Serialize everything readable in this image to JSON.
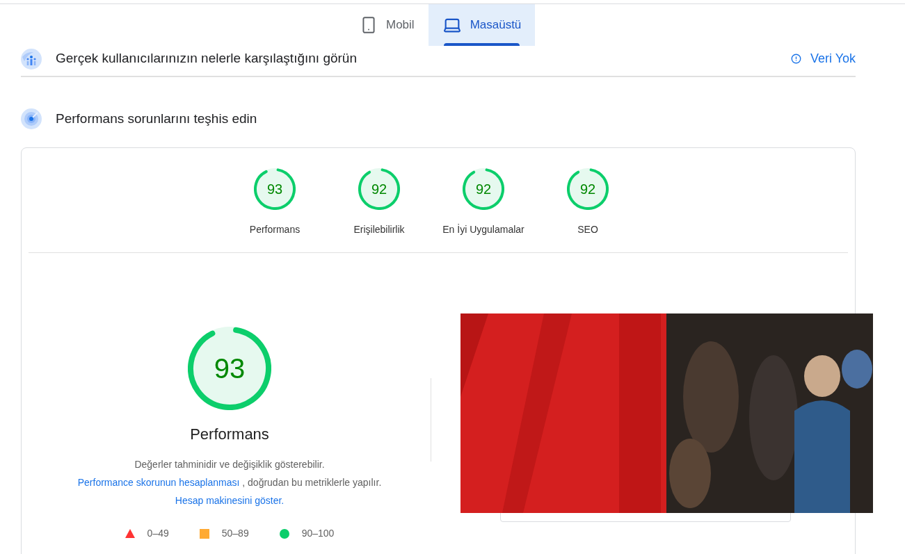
{
  "tabs": [
    {
      "label": "Mobil",
      "kind": "phone",
      "selected": false
    },
    {
      "label": "Masaüstü",
      "kind": "laptop",
      "selected": true
    }
  ],
  "field_data": {
    "title": "Gerçek kullanıcılarınızın nelerle karşılaştığını görün",
    "status": "Veri Yok"
  },
  "diagnostics": {
    "title": "Performans sorunlarını teşhis edin",
    "categories": [
      {
        "score": "93",
        "label": "Performans"
      },
      {
        "score": "92",
        "label": "Erişilebilirlik"
      },
      {
        "score": "92",
        "label": "En İyi Uygulamalar"
      },
      {
        "score": "92",
        "label": "SEO"
      }
    ],
    "main_score": {
      "score": "93",
      "label": "Performans"
    },
    "description": [
      {
        "kind": "text",
        "text": "Değerler tahminidir ve değişiklik gösterebilir. "
      },
      {
        "kind": "link",
        "text": "Performance skorunun hesaplanması"
      },
      {
        "kind": "text",
        "text": " , doğrudan bu metriklerle yapılır. "
      },
      {
        "kind": "link",
        "text": "Hesap makinesini göster."
      }
    ],
    "legend": [
      {
        "kind": "triangle",
        "color": "#ff3333",
        "range": "0–49"
      },
      {
        "kind": "square",
        "color": "#ffaa33",
        "range": "50–89"
      },
      {
        "kind": "circle",
        "color": "#0cce6b",
        "range": "90–100"
      }
    ]
  }
}
